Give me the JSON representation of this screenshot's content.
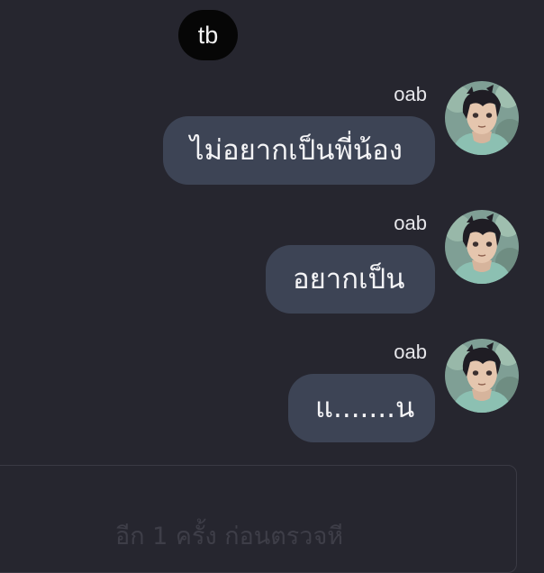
{
  "header": {
    "avatar_text": "tb"
  },
  "messages": [
    {
      "sender": "oab",
      "text": "ไม่อยากเป็นพี่น้อง",
      "avatar": "anime-boy-avatar"
    },
    {
      "sender": "oab",
      "text": "อยากเป็น",
      "avatar": "anime-boy-avatar"
    },
    {
      "sender": "oab",
      "text": "แ.......น",
      "avatar": "anime-boy-avatar"
    }
  ],
  "composer": {
    "placeholder": "อีก 1 ครั้ง ก่อนตรวจหี"
  },
  "colors": {
    "background": "#26262f",
    "bubble": "#3d4455",
    "text": "#f4f4f6",
    "top_avatar_bg": "#060606"
  }
}
